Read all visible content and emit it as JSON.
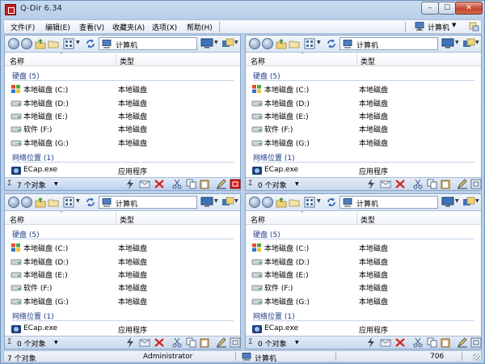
{
  "window": {
    "title": "Q-Dir 6.34",
    "min": "–",
    "max": "☐",
    "close": "✕"
  },
  "menu": {
    "items": [
      "文件(F)",
      "编辑(E)",
      "查看(V)",
      "收藏夹(A)",
      "选项(X)",
      "帮助(H)"
    ],
    "computer_label": "计算机",
    "computer_arrow": "▼"
  },
  "icons": {
    "nav": [
      "back-icon",
      "forward-icon",
      "up-folder-icon",
      "folder-icon",
      "view-grid-icon",
      "refresh-icon"
    ],
    "path": "computer-icon",
    "drive": "drive-icon",
    "system_drive": "windows-drive-icon",
    "app": "app-icon"
  },
  "colors": {
    "group": "#1e3a8a",
    "active_status": "#b9d0ee",
    "close_button": "#c6442f"
  },
  "panes": [
    {
      "id": "tl",
      "path": "计算机",
      "column_name": "名称",
      "column_type": "类型",
      "sort_indicator": "⌃",
      "group_drives": "硬盘 (5)",
      "drives": [
        {
          "name": "本地磁盘 (C:)",
          "type": "本地磁盘"
        },
        {
          "name": "本地磁盘 (D:)",
          "type": "本地磁盘"
        },
        {
          "name": "本地磁盘 (E:)",
          "type": "本地磁盘"
        },
        {
          "name": "软件 (F:)",
          "type": "本地磁盘"
        },
        {
          "name": "本地磁盘 (G:)",
          "type": "本地磁盘"
        }
      ],
      "group_network": "网络位置 (1)",
      "network": [
        {
          "name": "ECap.exe",
          "type": "应用程序"
        }
      ],
      "sigma": "Σ",
      "status_count": "7 个对象",
      "status_arrow": "▼"
    },
    {
      "id": "tr",
      "path": "计算机",
      "column_name": "名称",
      "column_type": "类型",
      "sort_indicator": "⌃",
      "group_drives": "硬盘 (5)",
      "drives": [
        {
          "name": "本地磁盘 (C:)",
          "type": "本地磁盘"
        },
        {
          "name": "本地磁盘 (D:)",
          "type": "本地磁盘"
        },
        {
          "name": "本地磁盘 (E:)",
          "type": "本地磁盘"
        },
        {
          "name": "软件 (F:)",
          "type": "本地磁盘"
        },
        {
          "name": "本地磁盘 (G:)",
          "type": "本地磁盘"
        }
      ],
      "group_network": "网络位置 (1)",
      "network": [
        {
          "name": "ECap.exe",
          "type": "应用程序"
        }
      ],
      "sigma": "Σ",
      "status_count": "0 个对象",
      "status_arrow": "▼"
    },
    {
      "id": "bl",
      "path": "计算机",
      "column_name": "名称",
      "column_type": "类型",
      "sort_indicator": "⌃",
      "group_drives": "硬盘 (5)",
      "drives": [
        {
          "name": "本地磁盘 (C:)",
          "type": "本地磁盘"
        },
        {
          "name": "本地磁盘 (D:)",
          "type": "本地磁盘"
        },
        {
          "name": "本地磁盘 (E:)",
          "type": "本地磁盘"
        },
        {
          "name": "软件 (F:)",
          "type": "本地磁盘"
        },
        {
          "name": "本地磁盘 (G:)",
          "type": "本地磁盘"
        }
      ],
      "group_network": "网络位置 (1)",
      "network": [
        {
          "name": "ECap.exe",
          "type": "应用程序"
        }
      ],
      "sigma": "Σ",
      "status_count": "0 个对象",
      "status_arrow": "▼"
    },
    {
      "id": "br",
      "path": "计算机",
      "column_name": "名称",
      "column_type": "类型",
      "sort_indicator": "⌃",
      "group_drives": "硬盘 (5)",
      "drives": [
        {
          "name": "本地磁盘 (C:)",
          "type": "本地磁盘"
        },
        {
          "name": "本地磁盘 (D:)",
          "type": "本地磁盘"
        },
        {
          "name": "本地磁盘 (E:)",
          "type": "本地磁盘"
        },
        {
          "name": "软件 (F:)",
          "type": "本地磁盘"
        },
        {
          "name": "本地磁盘 (G:)",
          "type": "本地磁盘"
        }
      ],
      "group_network": "网络位置 (1)",
      "network": [
        {
          "name": "ECap.exe",
          "type": "应用程序"
        }
      ],
      "sigma": "Σ",
      "status_count": "0 个对象",
      "status_arrow": "▼"
    }
  ],
  "statusbar": {
    "objects": "7 个对象",
    "user": "Administrator",
    "computer": "计算机",
    "number": "706"
  }
}
